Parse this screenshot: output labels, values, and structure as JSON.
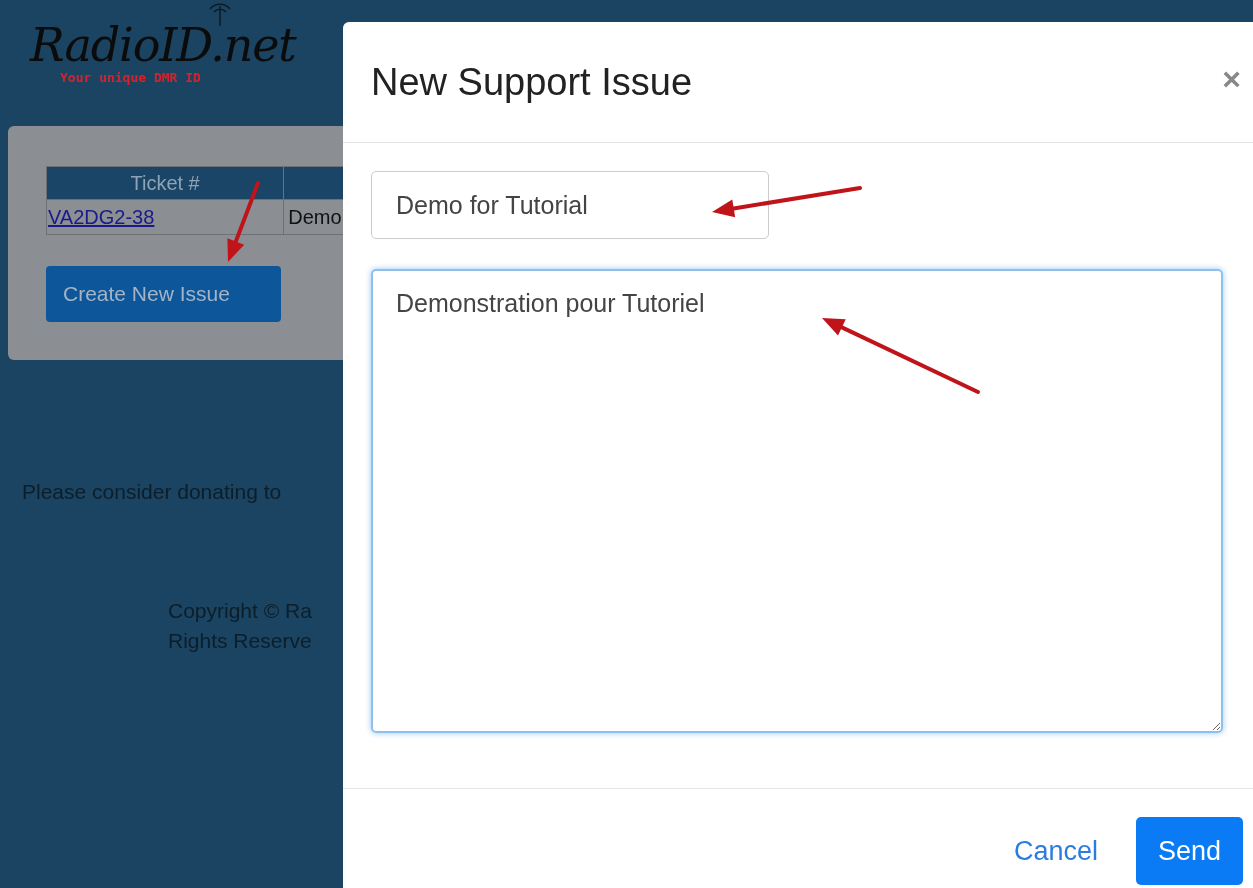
{
  "page": {
    "logo": {
      "name": "RadioID.net",
      "tagline": "Your unique DMR ID"
    },
    "table": {
      "columns": [
        "Ticket #"
      ],
      "rows": [
        {
          "ticket": "VA2DG2-38",
          "subject": "Demo"
        }
      ]
    },
    "create_button": "Create New Issue",
    "donate_text": "Please consider donating to",
    "copyright": [
      "Copyright © Ra",
      "Rights Reserve"
    ]
  },
  "modal": {
    "title": "New Support Issue",
    "close": "×",
    "subject": {
      "value": "Demo for Tutorial"
    },
    "message": {
      "value": "Demonstration pour Tutoriel",
      "focused": true
    },
    "buttons": [
      {
        "label": "Cancel",
        "kind": "link"
      },
      {
        "label": "Send",
        "kind": "primary"
      }
    ]
  }
}
